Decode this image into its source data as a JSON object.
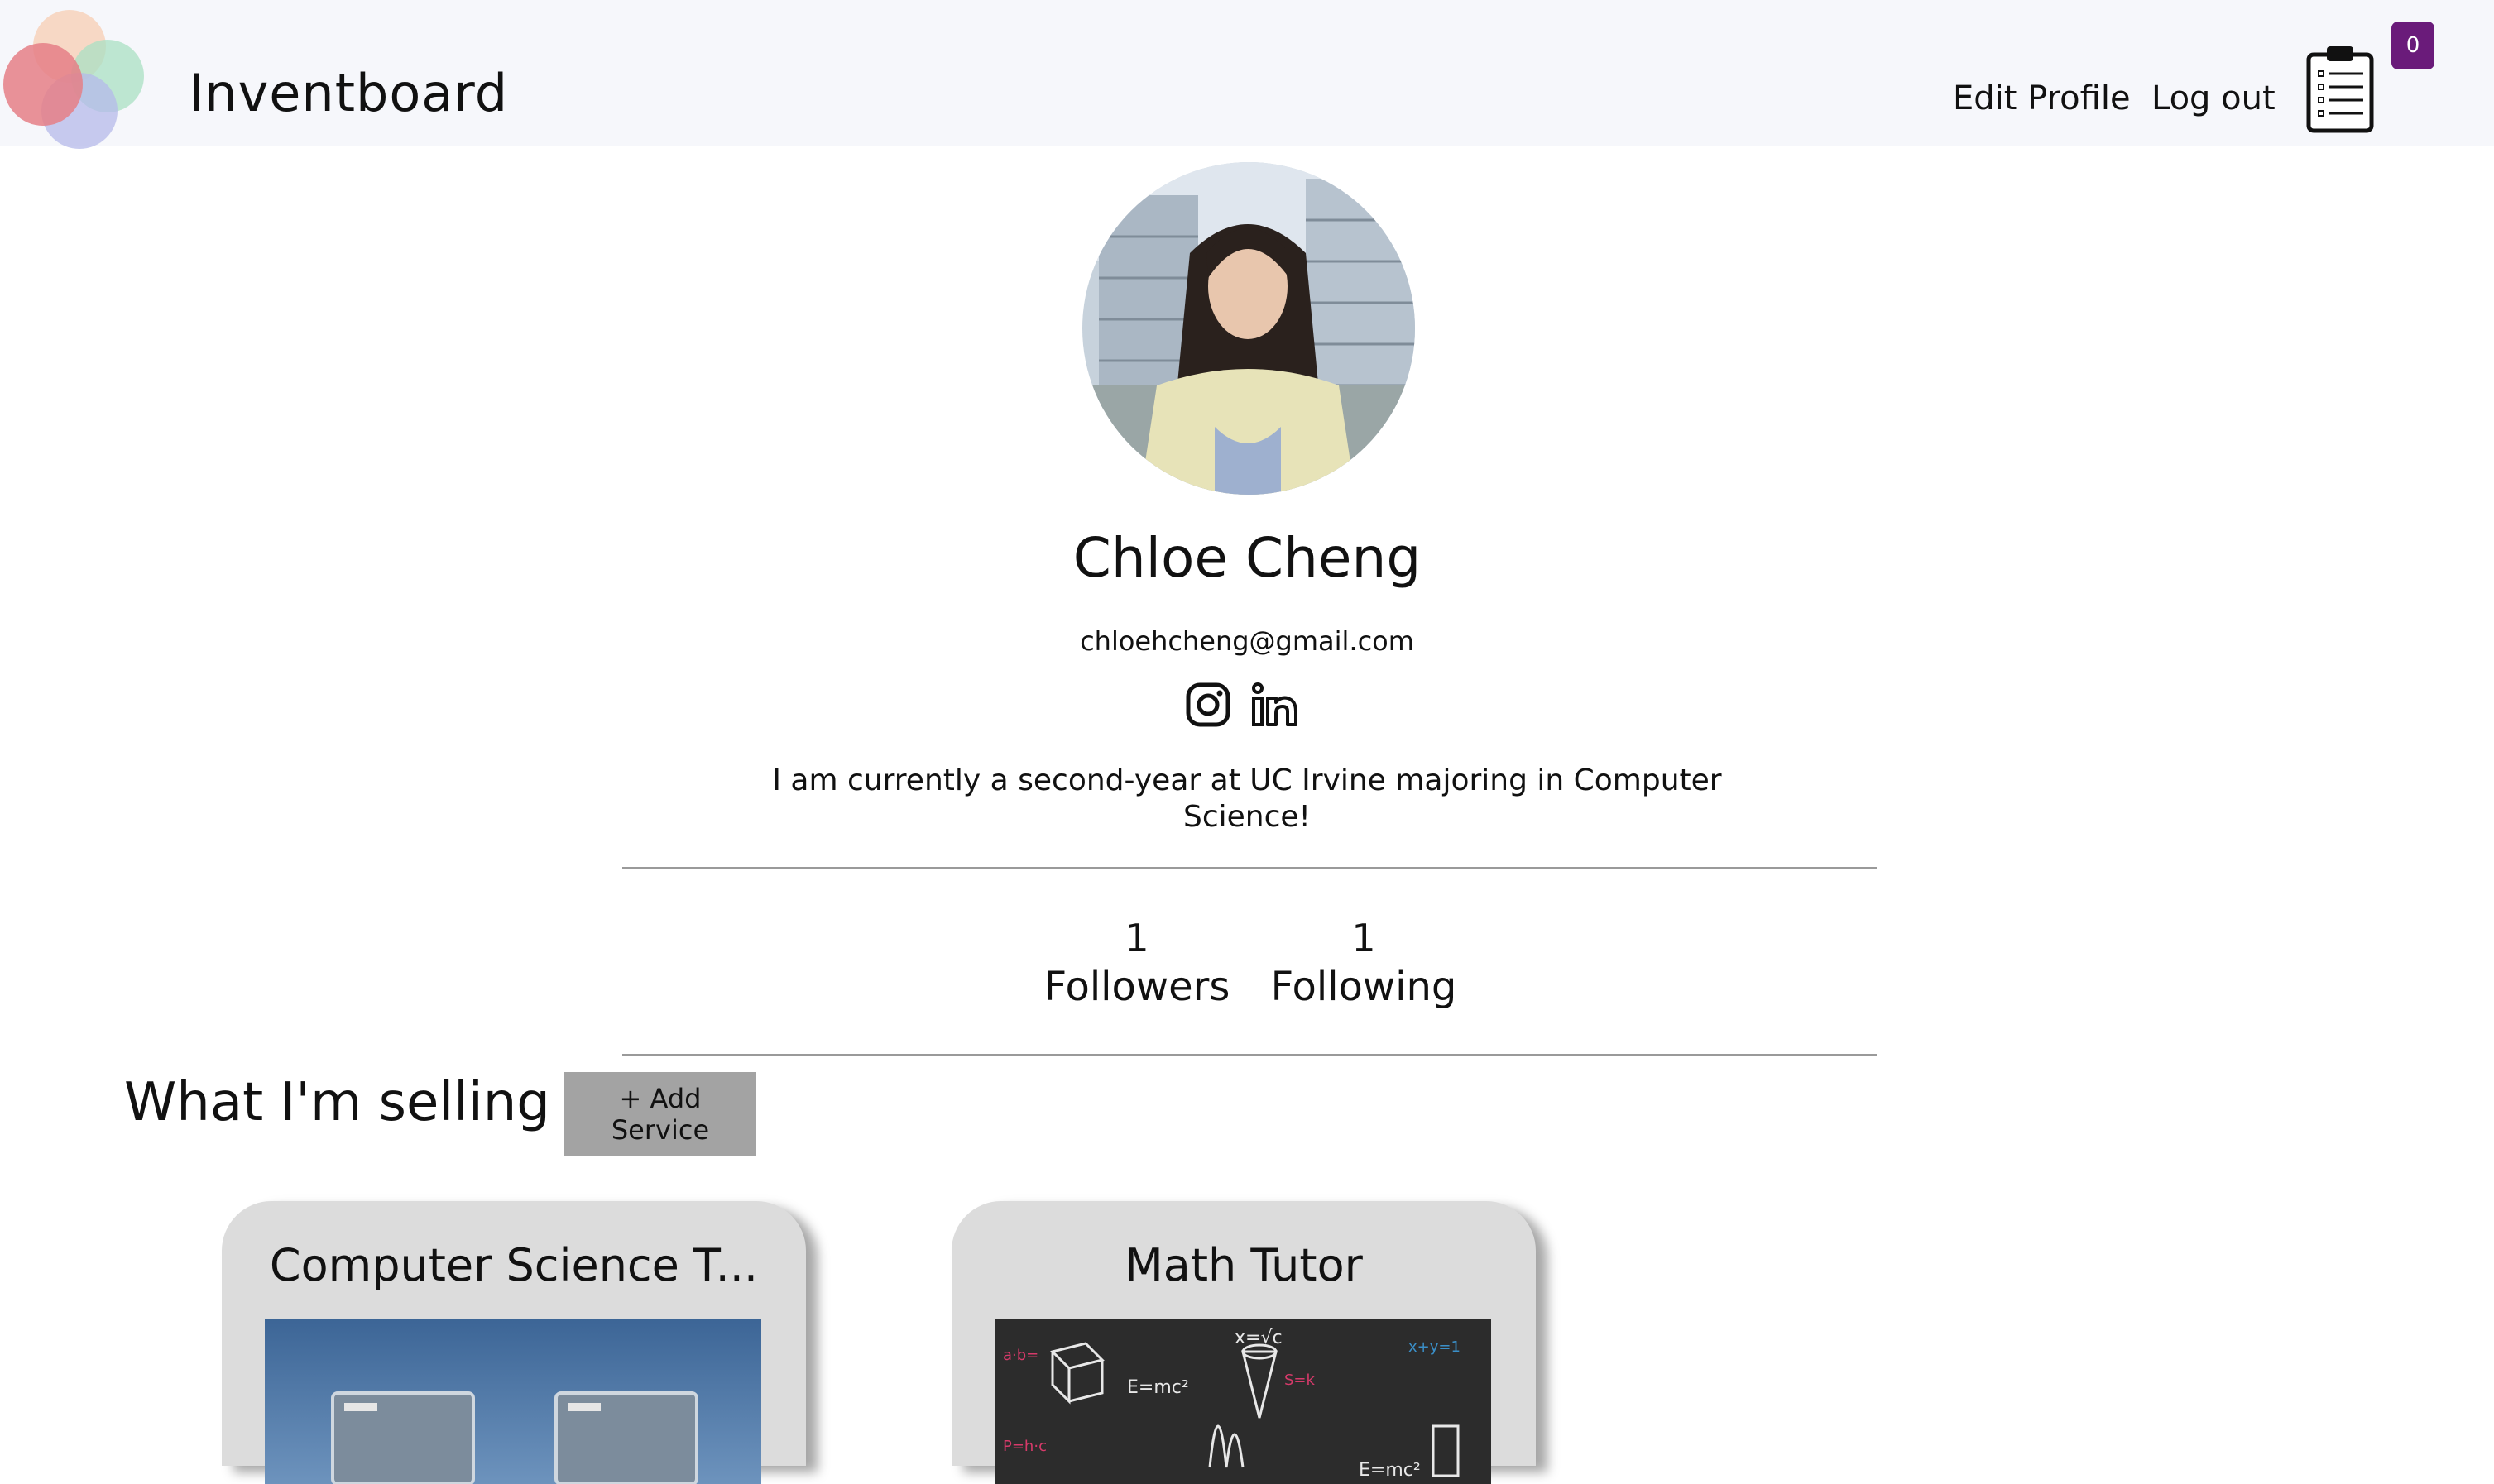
{
  "header": {
    "brand": "Inventboard",
    "edit_profile_label": "Edit Profile",
    "logout_label": "Log out",
    "cart_count": "0",
    "cart_icon": "clipboard-list-icon"
  },
  "profile": {
    "name": "Chloe Cheng",
    "email": "chloehcheng@gmail.com",
    "bio": "I am currently a second-year at UC Irvine majoring in Computer Science!",
    "social_icons": [
      "instagram-icon",
      "linkedin-icon"
    ],
    "followers_count": "1",
    "followers_label": "Followers",
    "following_count": "1",
    "following_label": "Following"
  },
  "selling": {
    "title": "What I'm selling",
    "add_button_label": "+ Add Service",
    "cards": [
      {
        "title": "Computer Science T..."
      },
      {
        "title": "Math Tutor"
      }
    ]
  },
  "colors": {
    "header_bg": "#f6f7fb",
    "badge": "#6a1b7a",
    "add_button": "#a3a3a3",
    "card_bg": "#dcdcdc",
    "divider": "#9a9a9a"
  }
}
